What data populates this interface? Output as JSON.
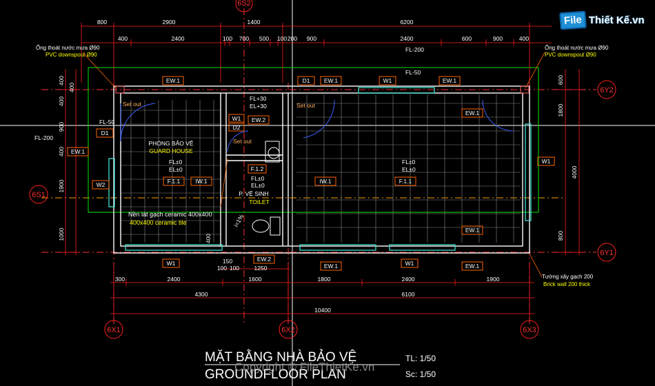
{
  "brand": {
    "box": "File",
    "name": "Thiết Kế.vn"
  },
  "dims_top": {
    "row1": [
      "800",
      "2900",
      "1400",
      "6200"
    ],
    "row2": [
      "400",
      "2400",
      "100",
      "700",
      "500",
      "100",
      "200",
      "900",
      "2400",
      "600",
      "900",
      "400"
    ]
  },
  "dims_bottom": {
    "row1": [
      "300",
      "2400",
      "1600",
      "1800",
      "2400",
      "1900"
    ],
    "row2": [
      "4300",
      "6100"
    ],
    "total": "10400",
    "detail": [
      "150",
      "100",
      "100",
      "1250"
    ]
  },
  "dims_left": [
    "400",
    "400",
    "900",
    "400",
    "1900",
    "1000"
  ],
  "dims_left_extra": "400",
  "dims_right": [
    "600",
    "1800",
    "4000",
    "800"
  ],
  "axes": {
    "top": "6S2",
    "left": "6S1",
    "right_top": "6Y2",
    "right_bottom": "6Y1",
    "bottom": [
      "6X1",
      "6X2",
      "6X3"
    ]
  },
  "labels": {
    "ew1": "EW.1",
    "ew2": "EW.2",
    "iw1": "IW.1",
    "f11": "F.1.1",
    "f12": "F.1.2",
    "d1": "D1",
    "d2": "D2",
    "w1": "W1",
    "w2": "W2",
    "fl50": "FL-50",
    "fl200": "FL-200",
    "fl30": "FL+30",
    "el30": "EL+30",
    "fl0": "FL±0",
    "el0": "EL±0",
    "setout": "Set out",
    "slope": "i=1%"
  },
  "rooms": {
    "guard_vn": "PHÒNG BẢO VỆ",
    "guard_en": "GUARD HOUSE",
    "toilet_vn": "P. VỆ SINH",
    "toilet_en": "TOILET"
  },
  "notes": {
    "downspout_vn": "Ống thoát nước mưa Ø90",
    "downspout_en": "PVC downspout Ø90",
    "tile_vn": "Nền lát gạch ceramic 400x400",
    "tile_en": "400x400 ceramic tile",
    "wall_vn": "Tường xây gạch 200",
    "wall_en": "Brick wall 200 thick"
  },
  "title": {
    "vn": "MẶT BẰNG NHÀ BẢO VỆ",
    "en": "GROUNDFLOOR PLAN",
    "scale1": "TL: 1/50",
    "scale2": "Sc: 1/50",
    "watermark": "Copyright © FileThietKe.vn"
  },
  "colors": {
    "bg": "#000000",
    "wall": "#ffffff",
    "dim": "#ff0000",
    "tag": "#ff6600",
    "text_y": "#ffff00",
    "green": "#00c000",
    "cyan": "#40e0d0"
  }
}
